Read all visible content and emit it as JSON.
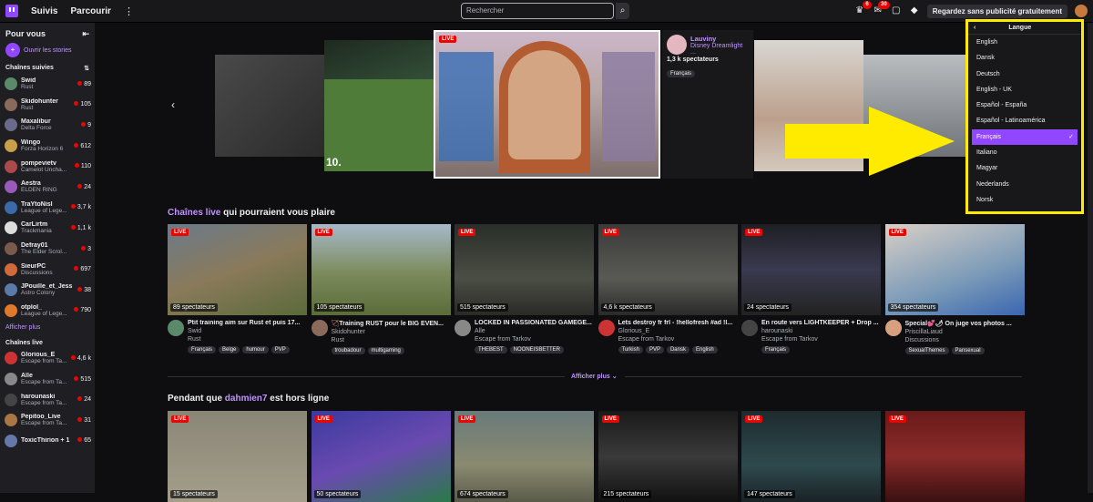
{
  "nav": {
    "links": [
      "Suivis",
      "Parcourir"
    ],
    "search_placeholder": "Rechercher",
    "badges": [
      "6",
      "30"
    ],
    "adfree_label": "Regardez sans publicité gratuitement"
  },
  "sidebar": {
    "for_you": "Pour vous",
    "stories": "Ouvrir les stories",
    "followed_title": "Chaînes suivies",
    "followed": [
      {
        "name": "Swid",
        "game": "Rust",
        "viewers": "89",
        "color": "#5a8a6a"
      },
      {
        "name": "Skidohunter",
        "game": "Rust",
        "viewers": "105",
        "color": "#8a6a5a"
      },
      {
        "name": "Maxalibur",
        "game": "Delta Force",
        "viewers": "9",
        "color": "#6a6a8a"
      },
      {
        "name": "Wingo",
        "game": "Forza Horizon 6",
        "viewers": "612",
        "color": "#c9a04a"
      },
      {
        "name": "pompevietv",
        "game": "Camelot Uncha...",
        "viewers": "110",
        "color": "#aa4a4a"
      },
      {
        "name": "Aestra",
        "game": "ELDEN RING",
        "viewers": "24",
        "color": "#9a5aba"
      },
      {
        "name": "TraYtoNisl",
        "game": "League of Lege...",
        "viewers": "3,7 k",
        "color": "#3a6aaa"
      },
      {
        "name": "CarLirtm",
        "game": "Trackmania",
        "viewers": "1,1 k",
        "color": "#ddd"
      },
      {
        "name": "Defray01",
        "game": "The Elder Scrol...",
        "viewers": "3",
        "color": "#7a5a4a"
      },
      {
        "name": "SieurPC",
        "game": "Discussions",
        "viewers": "697",
        "color": "#d06a3a"
      },
      {
        "name": "JPouille_et_Jess",
        "game": "Astro Colony",
        "viewers": "38",
        "color": "#5a7aaa"
      },
      {
        "name": "otplol_",
        "game": "League of Lege...",
        "viewers": "790",
        "color": "#e07a2a"
      }
    ],
    "show_more": "Afficher plus",
    "live_title": "Chaînes live",
    "live": [
      {
        "name": "Glorious_E",
        "game": "Escape from Ta...",
        "viewers": "4,6 k",
        "color": "#cc3333"
      },
      {
        "name": "Alle",
        "game": "Escape from Ta...",
        "viewers": "515",
        "color": "#888"
      },
      {
        "name": "harounaski",
        "game": "Escape from Ta...",
        "viewers": "24",
        "color": "#444"
      },
      {
        "name": "Pepitoo_Live",
        "game": "Escape from Ta...",
        "viewers": "31",
        "color": "#aa7744"
      },
      {
        "name": "ToxicThirion + 1",
        "game": "",
        "viewers": "65",
        "color": "#6677aa"
      }
    ]
  },
  "featured": {
    "live": "LIVE",
    "channel": "Lauviny",
    "game": "Disney Dreamlight ...",
    "viewers": "1,3 k spectateurs",
    "tag": "Français",
    "left_number": "10."
  },
  "language_menu": {
    "title": "Langue",
    "items": [
      "English",
      "Dansk",
      "Deutsch",
      "English - UK",
      "Español - España",
      "Español - Latinoamérica",
      "Français",
      "Italiano",
      "Magyar",
      "Nederlands",
      "Norsk"
    ],
    "selected": "Français"
  },
  "section1": {
    "title_hl": "Chaînes live",
    "title_rest": " qui pourraient vous plaire",
    "cards": [
      {
        "live": "LIVE",
        "viewers": "89 spectateurs",
        "title": "Ptit training aim sur Rust et puis 17...",
        "channel": "Swid",
        "game": "Rust",
        "tags": [
          "Français",
          "Belge",
          "humour",
          "PVP"
        ],
        "bg": "linear-gradient(160deg,#6b7a8a,#8a7a5a 50%,#5a6a3a)",
        "av": "#5a8a6a"
      },
      {
        "live": "LIVE",
        "viewers": "105 spectateurs",
        "title": "🏹Training RUST pour le BIG EVEN...",
        "channel": "Skidohunter",
        "game": "Rust",
        "tags": [
          "troubadour",
          "multigaming"
        ],
        "bg": "linear-gradient(180deg,#a7b9c9,#7a8a5a 55%,#5c6b3a)",
        "av": "#8a6a5a"
      },
      {
        "live": "LIVE",
        "viewers": "515 spectateurs",
        "title": "LOCKED IN PASSIONATED GAMEGE...",
        "channel": "Alle",
        "game": "Escape from Tarkov",
        "tags": [
          "THEBEST",
          "NOONEISBETTER"
        ],
        "bg": "linear-gradient(180deg,#2a2e2a,#4a4e44 60%,#2a2a26)",
        "av": "#888"
      },
      {
        "live": "LIVE",
        "viewers": "4,6 k spectateurs",
        "title": "Lets destroy fr frl - !hellofresh #ad !l...",
        "channel": "Glorious_E",
        "game": "Escape from Tarkov",
        "tags": [
          "Turkish",
          "PVP",
          "Dansk",
          "English"
        ],
        "bg": "linear-gradient(180deg,#3a3a3a,#5a5a55 60%,#2a2a2a)",
        "av": "#cc3333"
      },
      {
        "live": "LIVE",
        "viewers": "24 spectateurs",
        "title": "En route vers LIGHTKEEPER + Drop ...",
        "channel": "harounaski",
        "game": "Escape from Tarkov",
        "tags": [
          "Français"
        ],
        "bg": "linear-gradient(180deg,#1e1e24,#3a3a50 50%,#222)",
        "av": "#444"
      },
      {
        "live": "LIVE",
        "viewers": "354 spectateurs",
        "title": "Special💕🌶 On juge vos photos ...",
        "channel": "PriscillaLiaud",
        "game": "Discussions",
        "tags": [
          "SexualThemes",
          "Pansexual"
        ],
        "bg": "linear-gradient(160deg,#d8cfc6,#7a9ab8 60%,#3a66b0)",
        "av": "#d9a080"
      }
    ]
  },
  "show_more": "Afficher plus",
  "section2": {
    "title_a": "Pendant que ",
    "title_hl": "dahmien7",
    "title_b": " est hors ligne",
    "cards": [
      {
        "live": "LIVE",
        "viewers": "15 spectateurs",
        "bg": "linear-gradient(180deg,#8a8676,#a49e8a)"
      },
      {
        "live": "LIVE",
        "viewers": "50 spectateurs",
        "bg": "linear-gradient(160deg,#3a3aa0,#6a4ab0 50%,#2a7a4a)"
      },
      {
        "live": "LIVE",
        "viewers": "674 spectateurs",
        "bg": "linear-gradient(180deg,#6a7a7a,#8a8a70 60%,#5a5a4a)"
      },
      {
        "live": "LIVE",
        "viewers": "215 spectateurs",
        "bg": "linear-gradient(180deg,#1a1a1a,#3a3a3a 50%,#111)"
      },
      {
        "live": "LIVE",
        "viewers": "147 spectateurs",
        "bg": "linear-gradient(180deg,#1e2a2e,#2e4a4e 60%,#1a2226)"
      },
      {
        "live": "LIVE",
        "viewers": "",
        "bg": "linear-gradient(180deg,#6a1a1a,#8a2a2a 50%,#3a1010)"
      }
    ]
  }
}
